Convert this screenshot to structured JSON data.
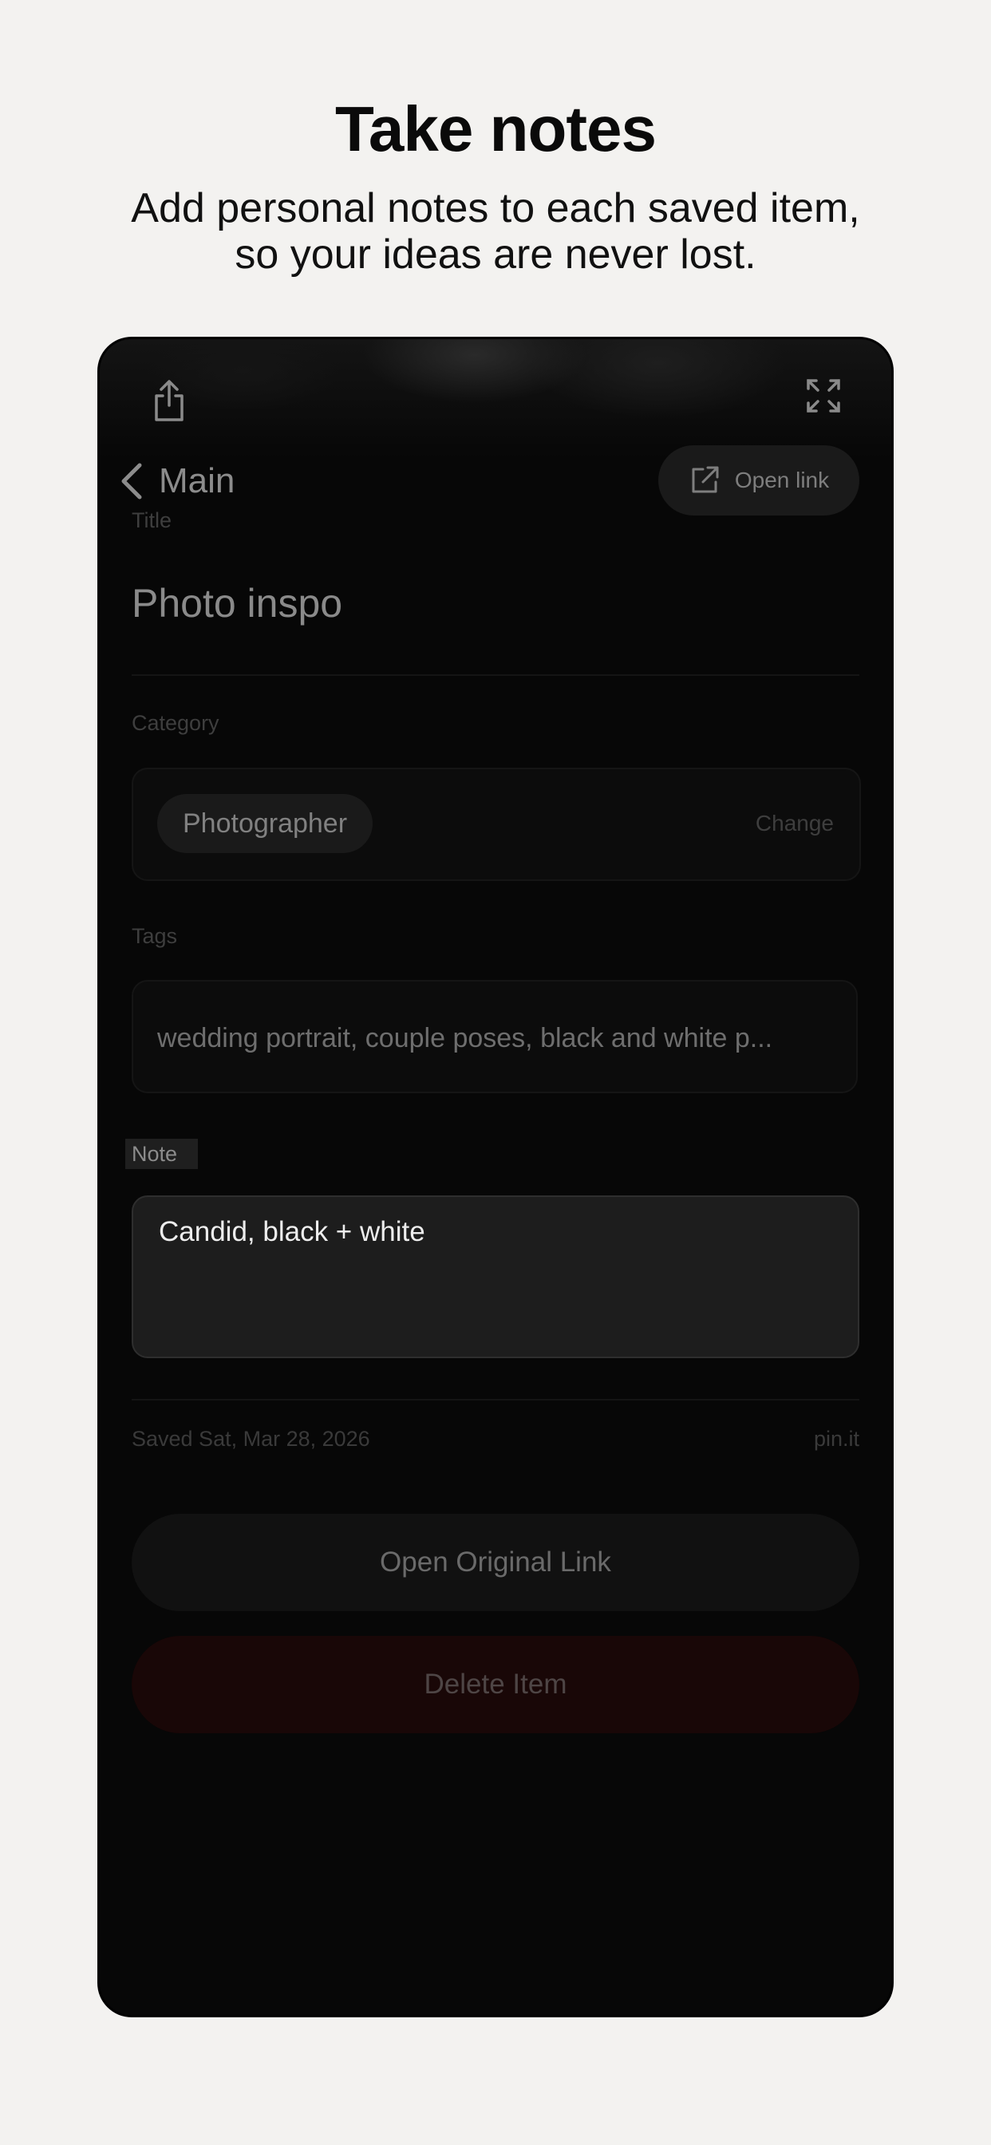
{
  "header": {
    "title": "Take notes",
    "subtitle_line1": "Add personal notes to each saved item,",
    "subtitle_line2": "so your ideas are never lost."
  },
  "toolbar": {
    "share_icon": "share-icon",
    "expand_icon": "expand-icon"
  },
  "nav": {
    "back_label": "Main",
    "open_link_label": "Open link"
  },
  "form": {
    "title_label": "Title",
    "title_value": "Photo inspo",
    "category_label": "Category",
    "category_value": "Photographer",
    "category_change_label": "Change",
    "tags_label": "Tags",
    "tags_value": "wedding portrait, couple poses, black and white p...",
    "note_label": "Note",
    "note_value": "Candid, black + white"
  },
  "meta": {
    "saved_text": "Saved Sat, Mar 28, 2026",
    "source": "pin.it"
  },
  "actions": {
    "open_original_label": "Open Original Link",
    "delete_label": "Delete Item"
  },
  "colors": {
    "page_background": "#f3f2f0",
    "screen_background": "#070707",
    "delete_background": "#190707"
  }
}
